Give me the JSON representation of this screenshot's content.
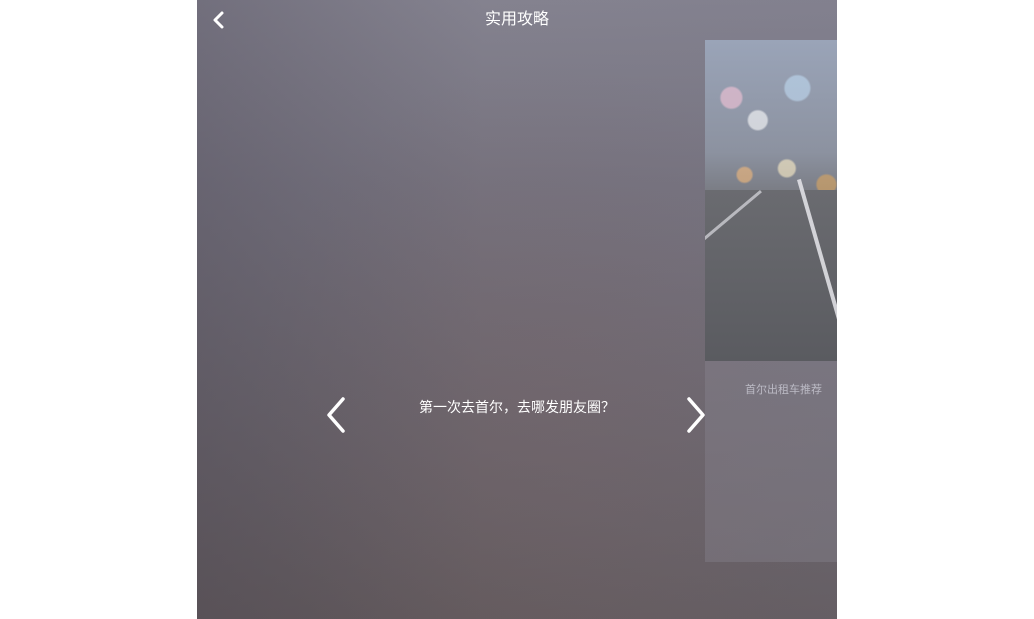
{
  "header": {
    "title": "实用攻略",
    "back_icon": "chevron-left-icon"
  },
  "carousel": {
    "current_title": "第一次去首尔，去哪发朋友圈？",
    "prev_icon": "chevron-left-icon",
    "next_icon": "chevron-right-icon",
    "next_card": {
      "caption": "首尔出租车推荐"
    }
  },
  "colors": {
    "text": "#ffffff",
    "background_top": "#84828f",
    "background_bottom": "#625a5d"
  }
}
